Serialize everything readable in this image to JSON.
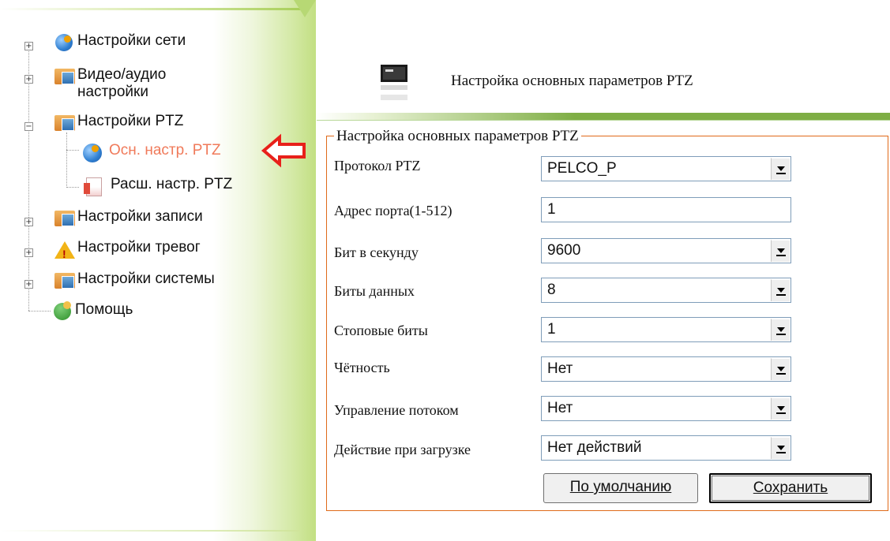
{
  "sidebar": {
    "items": [
      {
        "label": "Настройки сети",
        "icon": "network-globe-icon"
      },
      {
        "label": "Видео/аудио",
        "label2": "настройки",
        "icon": "folder-icon"
      },
      {
        "label": "Настройки PTZ",
        "icon": "folder-icon"
      },
      {
        "label": "Осн. настр. PTZ",
        "icon": "globe-search-icon",
        "active": true
      },
      {
        "label": "Расш. настр. PTZ",
        "icon": "document-icon"
      },
      {
        "label": "Настройки записи",
        "icon": "folder-icon"
      },
      {
        "label": "Настройки тревог",
        "icon": "warning-icon"
      },
      {
        "label": "Настройки системы",
        "icon": "folder-icon"
      },
      {
        "label": "Помощь",
        "icon": "help-users-icon"
      }
    ]
  },
  "header": {
    "title": "Настройка основных параметров PTZ"
  },
  "form": {
    "legend": "Настройка основных параметров PTZ",
    "fields": [
      {
        "label": "Протокол PTZ",
        "value": "PELCO_P",
        "type": "select"
      },
      {
        "label": "Адрес порта(1-512)",
        "value": "1",
        "type": "text"
      },
      {
        "label": "Бит в секунду",
        "value": "9600",
        "type": "select"
      },
      {
        "label": "Биты данных",
        "value": "8",
        "type": "select"
      },
      {
        "label": "Стоповые биты",
        "value": "1",
        "type": "select"
      },
      {
        "label": "Чётность",
        "value": "Нет",
        "type": "select"
      },
      {
        "label": "Управление потоком",
        "value": "Нет",
        "type": "select"
      },
      {
        "label": "Действие при загрузке",
        "value": "Нет действий",
        "type": "select"
      }
    ],
    "buttons": {
      "default_label": "По умолчанию",
      "save_label": "Сохранить"
    }
  },
  "colors": {
    "active_item": "#f07a5a",
    "arrow": "#e8201a",
    "fieldset_border": "#e06a1a",
    "header_line": "#7fae45"
  }
}
